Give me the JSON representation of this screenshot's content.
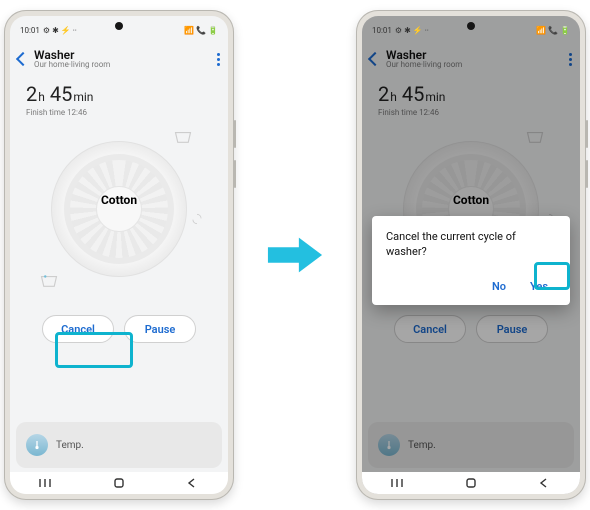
{
  "status": {
    "time": "10:01",
    "extra": "⚙ ✱ ⚡ ··",
    "right": "📶 📞 🔋"
  },
  "header": {
    "title": "Washer",
    "subtitle": "Our home·living room"
  },
  "time": {
    "h": "2",
    "h_unit": "h",
    "m": "45",
    "m_unit": "min",
    "finish_prefix": "Finish time ",
    "finish_val": "12:46"
  },
  "program": "Cotton",
  "buttons": {
    "cancel": "Cancel",
    "pause": "Pause"
  },
  "sheet": {
    "label": "Temp."
  },
  "dialog": {
    "message": "Cancel the current cycle of washer?",
    "no": "No",
    "yes": "Yes"
  }
}
